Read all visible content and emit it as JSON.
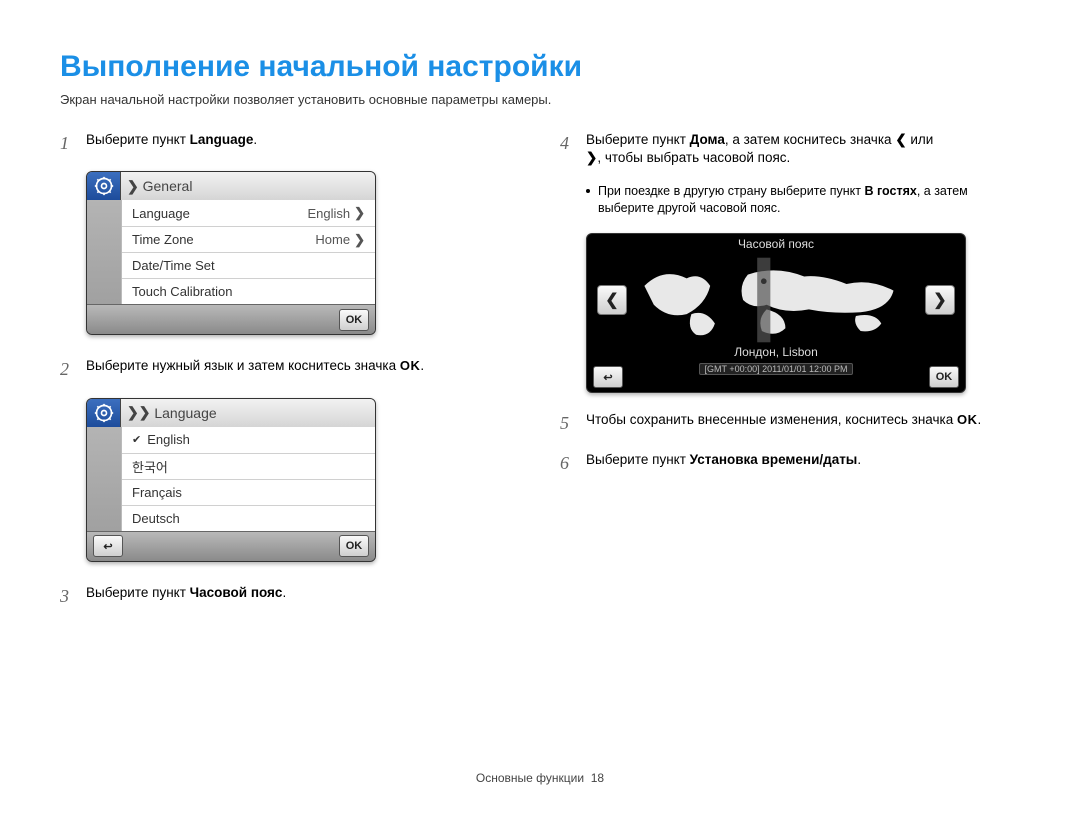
{
  "header": {
    "title": "Выполнение начальной настройки",
    "subtitle": "Экран начальной настройки позволяет установить основные параметры камеры."
  },
  "steps": {
    "s1": {
      "num": "1",
      "text_pre": "Выберите пункт ",
      "text_bold": "Language",
      "text_post": "."
    },
    "s2": {
      "num": "2",
      "text": "Выберите нужный язык и затем коснитесь значка ",
      "ok": "OK",
      "dot": "."
    },
    "s3": {
      "num": "3",
      "text_pre": "Выберите пункт ",
      "text_bold": "Часовой пояс",
      "text_post": "."
    },
    "s4": {
      "num": "4",
      "text_pre": "Выберите пункт ",
      "text_bold": "Дома",
      "text_mid": ", а затем коснитесь значка ",
      "text_post": " или ",
      "text_end": ", чтобы выбрать часовой пояс."
    },
    "s4_bullet": {
      "part1": "При поездке в другую страну выберите пункт ",
      "bold": "В гостях",
      "part2": ", а затем выберите другой часовой пояс."
    },
    "s5": {
      "num": "5",
      "text": "Чтобы сохранить внесенные изменения, коснитесь значка ",
      "ok": "OK",
      "dot": "."
    },
    "s6": {
      "num": "6",
      "text_pre": "Выберите пункт ",
      "text_bold": "Установка времени/даты",
      "text_post": "."
    }
  },
  "general_panel": {
    "title": "General",
    "rows": [
      {
        "label": "Language",
        "value": "English",
        "chevron": true
      },
      {
        "label": "Time Zone",
        "value": "Home",
        "chevron": true
      },
      {
        "label": "Date/Time Set",
        "value": "",
        "chevron": false
      },
      {
        "label": "Touch Calibration",
        "value": "",
        "chevron": false
      }
    ],
    "ok": "OK"
  },
  "language_panel": {
    "title": "Language",
    "rows": [
      "English",
      "한국어",
      "Français",
      "Deutsch"
    ],
    "ok": "OK"
  },
  "tz_panel": {
    "title": "Часовой пояс",
    "location": "Лондон, Lisbon",
    "gmt": "[GMT +00:00] 2011/01/01 12:00 PM",
    "ok": "OK"
  },
  "chart_data": {
    "type": "table",
    "title": "World time-zone selection (camera UI)",
    "selected_city": "Лондон, Lisbon",
    "gmt_offset": "+00:00",
    "datetime": "2011/01/01 12:00 PM"
  },
  "footer": {
    "section": "Основные функции",
    "page": "18"
  }
}
